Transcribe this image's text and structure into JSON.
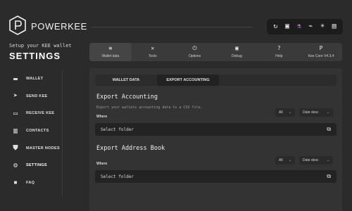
{
  "app": {
    "brand": "POWERKEE"
  },
  "header": {
    "icons": [
      {
        "name": "refresh-icon",
        "glyph": "↻"
      },
      {
        "name": "gift-icon",
        "glyph": "▣"
      },
      {
        "name": "flask-icon",
        "glyph": "⚗"
      },
      {
        "name": "wifi-off-icon",
        "glyph": "⌁"
      },
      {
        "name": "brightness-icon",
        "glyph": "☀"
      },
      {
        "name": "lock-icon",
        "glyph": "▤"
      }
    ]
  },
  "sidebar": {
    "subtitle": "Setup your KEE wallet",
    "title": "SETTINGS",
    "items": [
      {
        "label": "WALLET",
        "icon": "wallet-icon",
        "glyph": "▬"
      },
      {
        "label": "SEND KEE",
        "icon": "send-icon",
        "glyph": "➤"
      },
      {
        "label": "RECEIVE KEE",
        "icon": "receive-icon",
        "glyph": "▭"
      },
      {
        "label": "CONTACTS",
        "icon": "contacts-icon",
        "glyph": "▥"
      },
      {
        "label": "MASTER NODES",
        "icon": "shield-icon",
        "glyph": "⛊"
      },
      {
        "label": "SETTINGS",
        "icon": "gear-icon",
        "glyph": "⚙"
      },
      {
        "label": "FAQ",
        "icon": "chat-icon",
        "glyph": "▪"
      }
    ]
  },
  "tabs": [
    {
      "label": "Wallet data",
      "icon": "database-icon",
      "glyph": "≡"
    },
    {
      "label": "Tools",
      "icon": "tools-icon",
      "glyph": "✕"
    },
    {
      "label": "Options",
      "icon": "power-icon",
      "glyph": "⏻"
    },
    {
      "label": "Debug",
      "icon": "terminal-icon",
      "glyph": "▣"
    },
    {
      "label": "Help",
      "icon": "help-icon",
      "glyph": "?"
    },
    {
      "label": "Kee Core V4.3.4",
      "icon": "kee-logo-icon",
      "glyph": "P"
    }
  ],
  "subtabs": [
    {
      "label": "WALLET DATA"
    },
    {
      "label": "EXPORT ACCOUNTING"
    }
  ],
  "export_accounting": {
    "title": "Export Accounting",
    "description": "Export your wallets accounting data to a CSV file.",
    "where_label": "Where",
    "filter_value": "All",
    "sort_value": "Date desc",
    "folder_placeholder": "Select folder"
  },
  "export_address_book": {
    "title": "Export Address Book",
    "where_label": "Where",
    "filter_value": "All",
    "sort_value": "Date desc",
    "folder_placeholder": "Select folder"
  }
}
